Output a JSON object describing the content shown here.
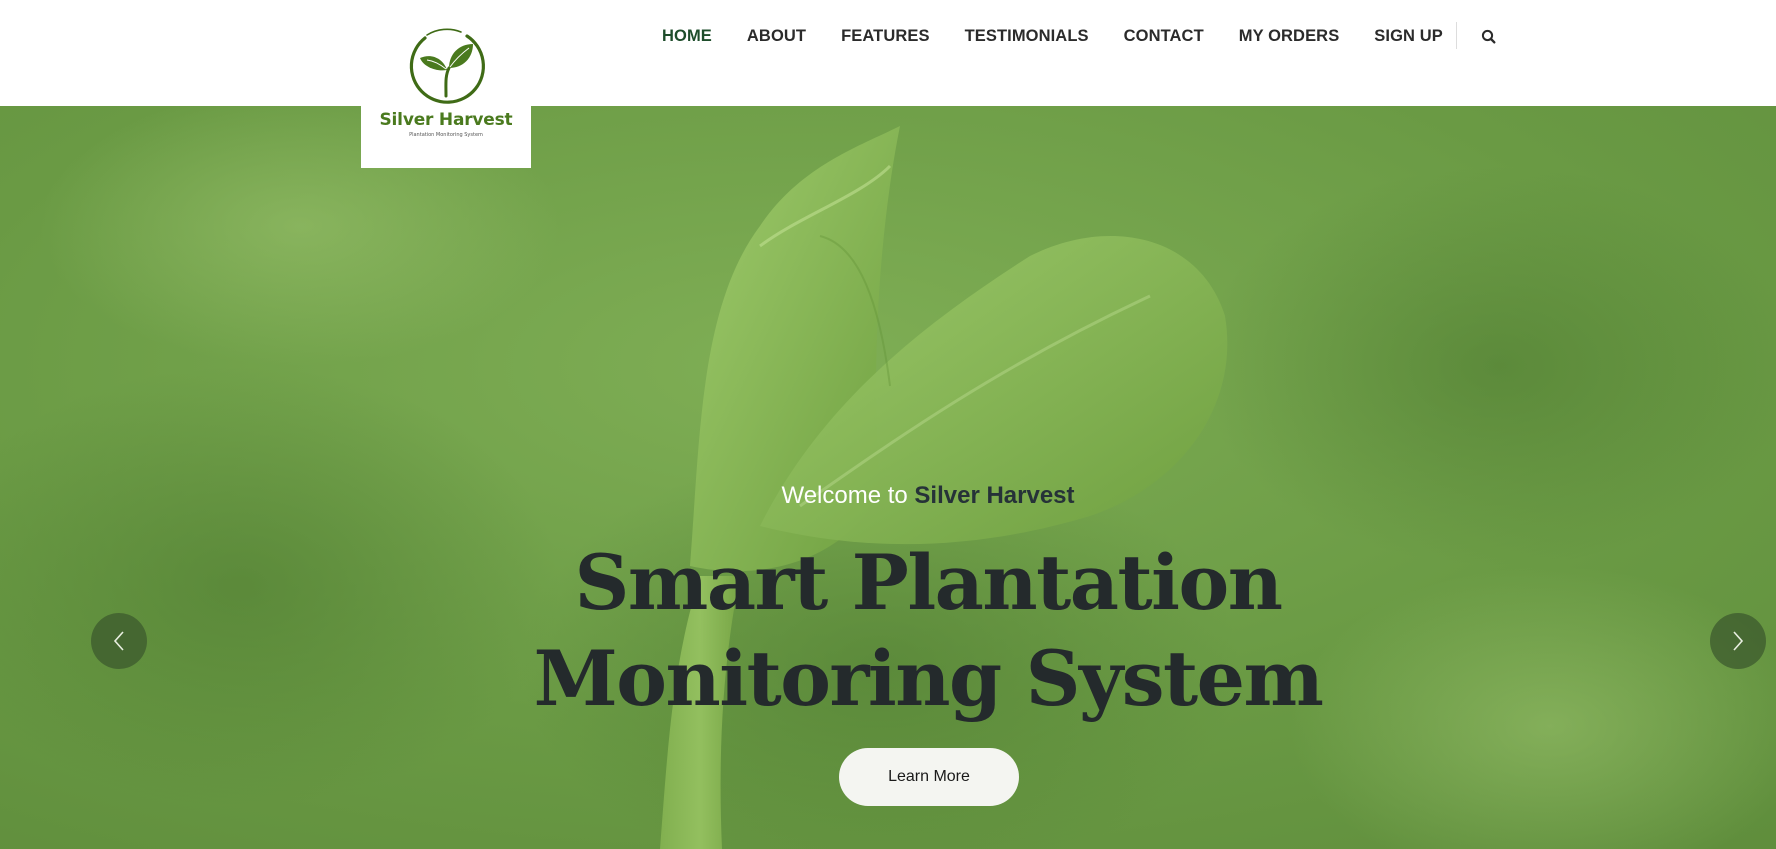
{
  "brand": {
    "name": "Silver Harvest",
    "tagline": "Plantation Monitoring System"
  },
  "nav": {
    "items": [
      {
        "label": "HOME",
        "active": true
      },
      {
        "label": "ABOUT"
      },
      {
        "label": "FEATURES"
      },
      {
        "label": "TESTIMONIALS"
      },
      {
        "label": "CONTACT"
      },
      {
        "label": "MY ORDERS"
      },
      {
        "label": "SIGN UP"
      }
    ],
    "search_icon": "search-icon"
  },
  "hero": {
    "welcome_prefix": "Welcome to",
    "welcome_brand": "Silver Harvest",
    "title_line1": "Smart Plantation",
    "title_line2": "Monitoring System",
    "cta_label": "Learn More",
    "prev_icon": "chevron-left-icon",
    "next_icon": "chevron-right-icon"
  },
  "colors": {
    "brand_green": "#4a7a1e",
    "nav_active": "#1e4d2b",
    "hero_bg": "#6f9c48",
    "title_dark": "#242a2c"
  }
}
